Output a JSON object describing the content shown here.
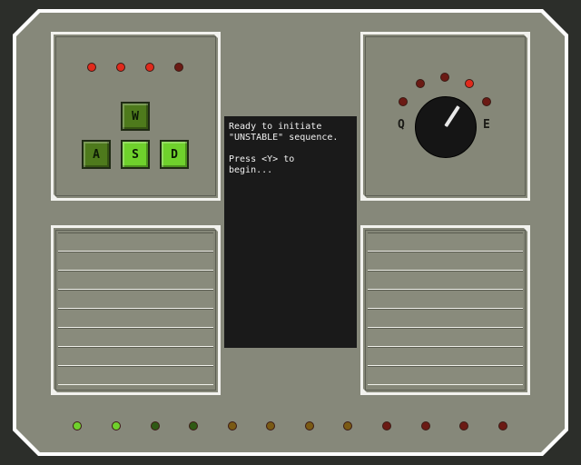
{
  "top_left_leds": [
    {
      "color": "#e02a1c"
    },
    {
      "color": "#e02a1c"
    },
    {
      "color": "#e02a1c"
    },
    {
      "color": "#6b1a14"
    }
  ],
  "keys": {
    "w": {
      "label": "W",
      "color": "#4e7a1c"
    },
    "a": {
      "label": "A",
      "color": "#4e7a1c"
    },
    "s": {
      "label": "S",
      "color": "#6fd12c"
    },
    "d": {
      "label": "D",
      "color": "#6fd12c"
    }
  },
  "knob": {
    "left_label": "Q",
    "right_label": "E",
    "leds": [
      {
        "color": "#6b1a14"
      },
      {
        "color": "#6b1a14"
      },
      {
        "color": "#6b1a14"
      },
      {
        "color": "#e02a1c"
      },
      {
        "color": "#6b1a14"
      }
    ]
  },
  "screen": {
    "lines_block1": [
      "Ready to initiate",
      "\"UNSTABLE\" sequence."
    ],
    "lines_block2": [
      "Press <Y> to",
      "begin..."
    ]
  },
  "bottom_leds": [
    {
      "color": "#6fd12c"
    },
    {
      "color": "#6fd12c"
    },
    {
      "color": "#2f5a14"
    },
    {
      "color": "#2f5a14"
    },
    {
      "color": "#7a5a14"
    },
    {
      "color": "#7a5a14"
    },
    {
      "color": "#7a5a14"
    },
    {
      "color": "#7a5a14"
    },
    {
      "color": "#6b1a14"
    },
    {
      "color": "#6b1a14"
    },
    {
      "color": "#6b1a14"
    },
    {
      "color": "#6b1a14"
    }
  ]
}
